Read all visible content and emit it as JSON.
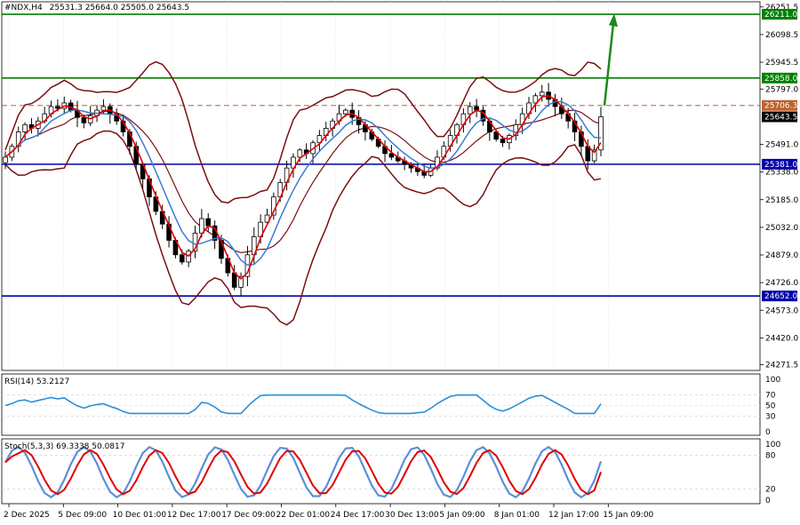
{
  "symbol_header": {
    "symbol": "#NDX,H4",
    "ohlc": "25531.3 25664.0 25505.0 25643.5"
  },
  "colors": {
    "background": "#ffffff",
    "grid": "#e6e6e6",
    "bull_candle": "#000000",
    "bear_candle": "#000000",
    "ma_fast": "#e00000",
    "ma_slow": "#3a7bd5",
    "bollinger": "#7a1010",
    "support_line": "#0000aa",
    "resistance_line": "#008000",
    "dashed_level": "#c0602a",
    "arrow": "#1a8a1a",
    "rsi_line": "#2b8fd9",
    "stoch_main": "#5b8fd9",
    "stoch_signal": "#e00000",
    "label_blue_bg": "#0000aa",
    "label_green_bg": "#008000",
    "label_orange_bg": "#c0602a",
    "label_current_bg": "#000000"
  },
  "price_axis": {
    "ticks": [
      "26251.5",
      "26098.5",
      "25945.5",
      "25797.0",
      "25491.0",
      "25338.0",
      "25185.0",
      "25032.0",
      "24879.0",
      "24726.0",
      "24573.0",
      "24420.0",
      "24271.5"
    ],
    "ymin": 24240,
    "ymax": 26280
  },
  "levels": [
    {
      "value": 26211.0,
      "label": "26211.0",
      "style": "solid",
      "color": "#008000"
    },
    {
      "value": 25858.0,
      "label": "25858.0",
      "style": "solid",
      "color": "#008000"
    },
    {
      "value": 25706.3,
      "label": "25706.3",
      "style": "dashed",
      "color": "#c0602a"
    },
    {
      "value": 25381.0,
      "label": "25381.0",
      "style": "solid",
      "color": "#0000aa"
    },
    {
      "value": 24652.0,
      "label": "24652.0",
      "style": "solid",
      "color": "#0000aa"
    }
  ],
  "current_price": {
    "value": 25643.5,
    "label": "25643.5"
  },
  "time_axis": {
    "labels": [
      "2 Dec 2025",
      "5 Dec 09:00",
      "10 Dec 01:00",
      "12 Dec 17:00",
      "17 Dec 09:00",
      "22 Dec 01:00",
      "24 Dec 17:00",
      "30 Dec 13:00",
      "5 Jan 09:00",
      "8 Jan 01:00",
      "12 Jan 17:00",
      "15 Jan 09:00"
    ]
  },
  "rsi_panel": {
    "title": "RSI(14) 53.2127",
    "ticks": [
      "100",
      "70",
      "50",
      "30",
      "0"
    ]
  },
  "stoch_panel": {
    "title": "Stoch(5,3,3) 69.3338 50.0817",
    "ticks": [
      "100",
      "80",
      "20",
      "0"
    ]
  },
  "chart_data": {
    "type": "candlestick",
    "title": "#NDX,H4",
    "ylim": [
      24271.5,
      26251.5
    ],
    "close_series": [
      25420,
      25480,
      25560,
      25600,
      25580,
      25620,
      25660,
      25700,
      25690,
      25720,
      25680,
      25640,
      25610,
      25650,
      25680,
      25700,
      25660,
      25620,
      25560,
      25480,
      25380,
      25300,
      25200,
      25120,
      25050,
      24960,
      24880,
      24840,
      24900,
      25000,
      25080,
      25040,
      24960,
      24860,
      24780,
      24700,
      24760,
      24880,
      24980,
      25060,
      25100,
      25200,
      25280,
      25360,
      25420,
      25460,
      25440,
      25500,
      25540,
      25580,
      25620,
      25660,
      25680,
      25640,
      25600,
      25560,
      25520,
      25480,
      25440,
      25420,
      25400,
      25380,
      25360,
      25340,
      25320,
      25360,
      25420,
      25480,
      25540,
      25600,
      25660,
      25700,
      25680,
      25620,
      25560,
      25520,
      25500,
      25540,
      25600,
      25660,
      25720,
      25760,
      25780,
      25740,
      25700,
      25660,
      25620,
      25560,
      25480,
      25400,
      25460,
      25643.5
    ],
    "indicators": [
      "Bollinger Bands",
      "Moving Average (fast)",
      "Moving Average (slow)"
    ],
    "rsi_last": 53.2127,
    "stoch_main_last": 69.3338,
    "stoch_signal_last": 50.0817,
    "grid": true
  }
}
